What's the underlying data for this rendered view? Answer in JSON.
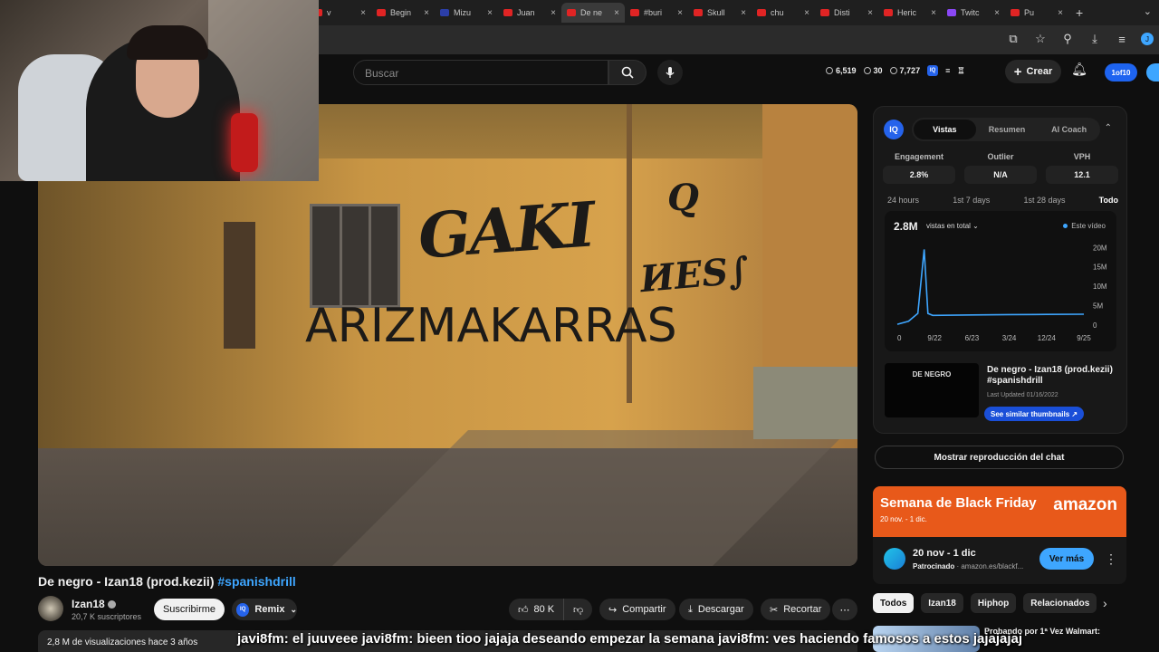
{
  "browser": {
    "tabs": [
      {
        "label": "v",
        "icon": "youtube-icon"
      },
      {
        "label": "Begin",
        "icon": "youtube-icon"
      },
      {
        "label": "Mizu",
        "icon": "site-icon"
      },
      {
        "label": "Juan",
        "icon": "youtube-icon"
      },
      {
        "label": "De ne",
        "icon": "youtube-icon"
      },
      {
        "label": "#buri",
        "icon": "youtube-icon"
      },
      {
        "label": "Skull",
        "icon": "youtube-icon"
      },
      {
        "label": "chu",
        "icon": "youtube-icon"
      },
      {
        "label": "Disti",
        "icon": "youtube-icon"
      },
      {
        "label": "Heric",
        "icon": "youtube-icon"
      },
      {
        "label": "Twitc",
        "icon": "twitch-icon"
      },
      {
        "label": "Pu",
        "icon": "youtube-icon"
      }
    ],
    "active_tab": 4
  },
  "header": {
    "search_placeholder": "Buscar",
    "stat1": "6,519",
    "stat2": "30",
    "stat3": "7,727",
    "create_label": "Crear",
    "counter_badge": "1of10"
  },
  "video": {
    "title_main": "De negro - Izan18 (prod.kezii)",
    "title_hashtag": "#spanishdrill",
    "channel_name": "Izan18",
    "subscribers": "20,7 K suscriptores",
    "subscribe_label": "Suscribirme",
    "remix_label": "Remix",
    "likes": "80 K",
    "share_label": "Compartir",
    "download_label": "Descargar",
    "clip_label": "Recortar",
    "views_line": "2,8 M de visualizaciones  hace 3 años"
  },
  "chat_overlay": "javi8fm: el juuveee javi8fm: bieen tioo jajaja deseando empezar la semana javi8fm: ves haciendo famosos a estos jajajajaj",
  "iq_panel": {
    "logo": "IQ",
    "tabs": [
      "Vistas",
      "Resumen",
      "AI Coach"
    ],
    "metrics": [
      {
        "label": "Engagement",
        "value": "2.8%"
      },
      {
        "label": "Outlier",
        "value": "N/A"
      },
      {
        "label": "VPH",
        "value": "12.1"
      }
    ],
    "ranges": [
      "24 hours",
      "1st 7 days",
      "1st 28 days",
      "Todo"
    ],
    "total_value": "2.8M",
    "total_selector": "vistas en total",
    "legend": "Este vídeo",
    "mini_thumb_text": "DE NEGRO",
    "mini_title": "De negro - Izan18 (prod.kezii) #spanishdrill",
    "mini_updated": "Last Updated 01/16/2022",
    "similar_label": "See similar thumbnails ↗"
  },
  "chart_data": {
    "type": "line",
    "x": [
      "0",
      "9/22",
      "6/23",
      "3/24",
      "12/24",
      "9/25"
    ],
    "x_values": [
      0,
      1,
      2,
      3,
      4,
      5
    ],
    "series": [
      {
        "name": "Este vídeo",
        "points": [
          [
            0,
            0.2
          ],
          [
            0.3,
            1.0
          ],
          [
            0.55,
            3.0
          ],
          [
            0.72,
            19.5
          ],
          [
            0.82,
            3.0
          ],
          [
            0.95,
            2.5
          ],
          [
            2,
            2.6
          ],
          [
            3,
            2.7
          ],
          [
            4,
            2.75
          ],
          [
            5,
            2.8
          ]
        ]
      }
    ],
    "yticks": [
      "0",
      "5M",
      "10M",
      "15M",
      "20M"
    ],
    "ytick_values": [
      0,
      5,
      10,
      15,
      20
    ],
    "ylim": [
      0,
      21
    ],
    "xlim": [
      0,
      5
    ],
    "color": "#3ea6ff"
  },
  "replay_label": "Mostrar reproducción del chat",
  "ad": {
    "headline": "Semana de Black Friday",
    "dates_small": "20 nov. - 1 dic.",
    "logo": "amazon",
    "dates": "20 nov - 1 dic",
    "sponsor_label": "Patrocinado",
    "sponsor_url": "· amazon.es/blackf...",
    "cta": "Ver más"
  },
  "chips": [
    "Todos",
    "Izan18",
    "Hiphop",
    "Relacionados"
  ],
  "next_video_title": "Probando por 1ª Vez Walmart:"
}
